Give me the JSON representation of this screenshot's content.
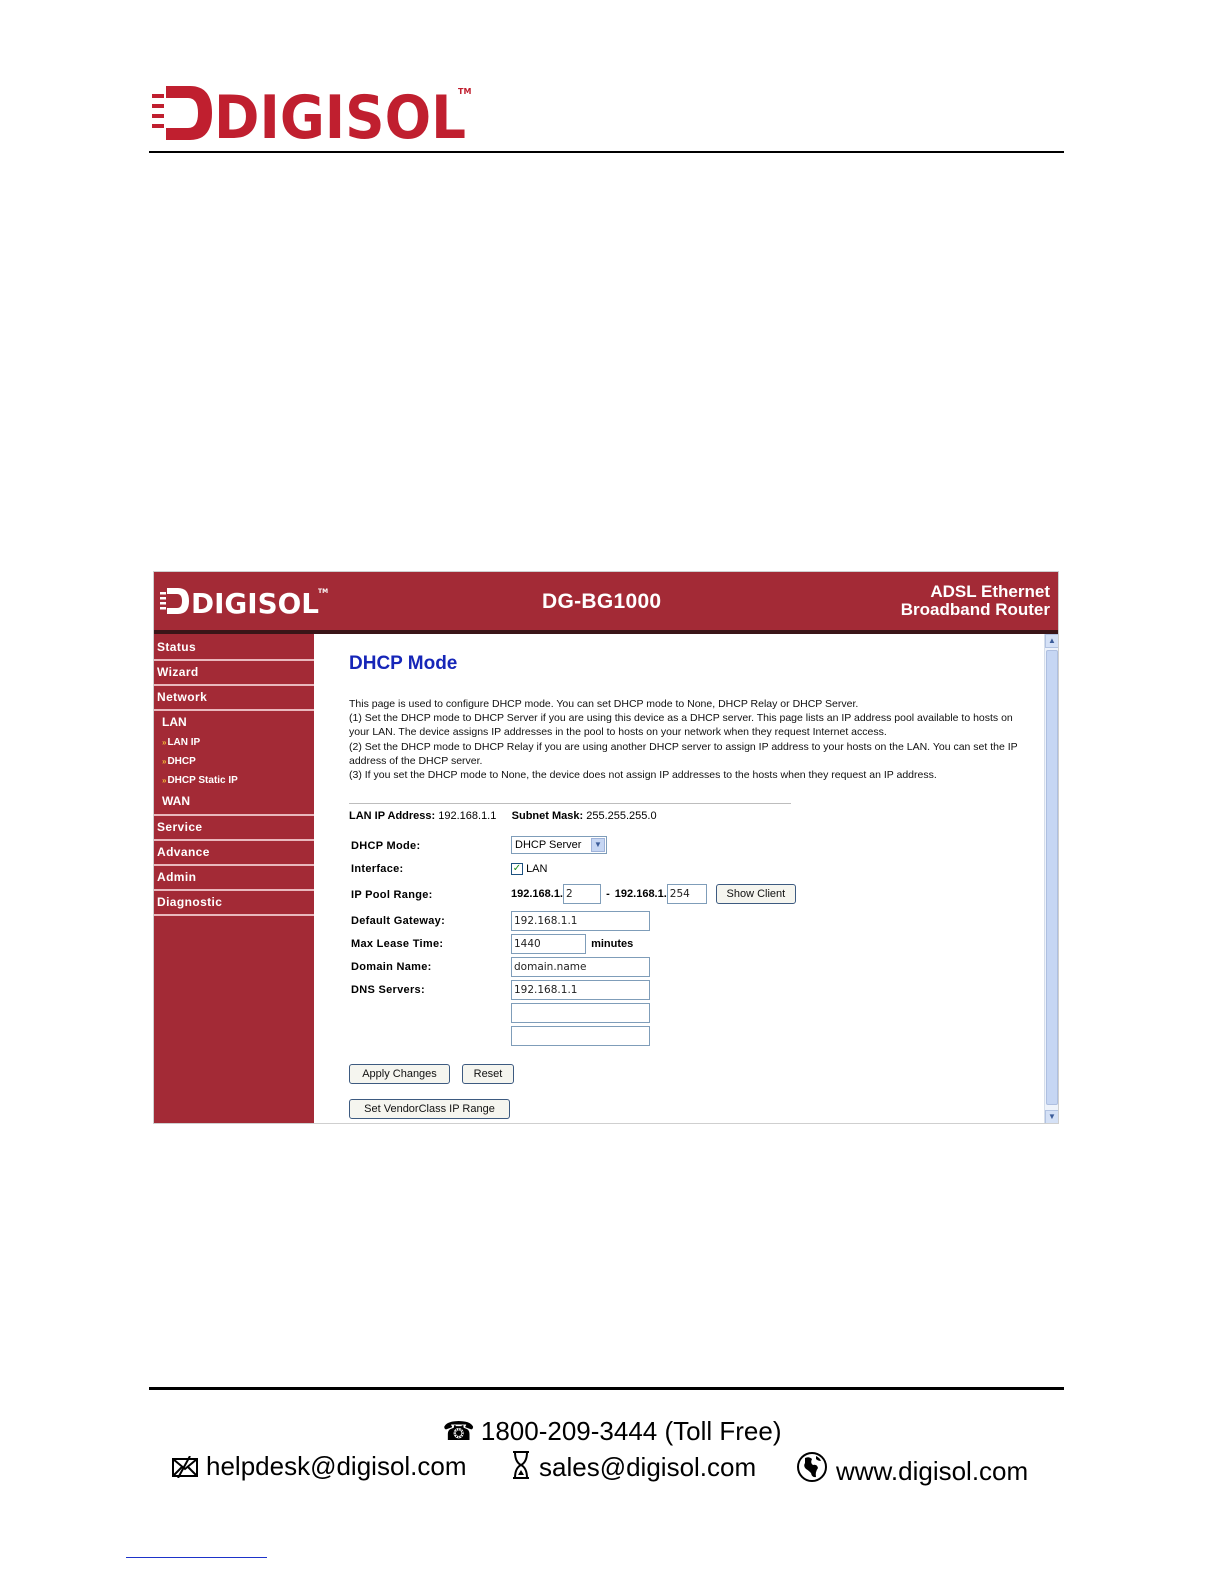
{
  "brand": {
    "name": "DIGISOL",
    "tm": "TM"
  },
  "router": {
    "model": "DG-BG1000",
    "tagline_line1": "ADSL Ethernet",
    "tagline_line2": "Broadband Router"
  },
  "sidebar": {
    "items": [
      {
        "label": "Status"
      },
      {
        "label": "Wizard"
      },
      {
        "label": "Network"
      }
    ],
    "lan_head": "LAN",
    "lan_links": [
      {
        "label": "LAN IP"
      },
      {
        "label": "DHCP"
      },
      {
        "label": "DHCP Static IP"
      }
    ],
    "wan_head": "WAN",
    "items_after": [
      {
        "label": "Service"
      },
      {
        "label": "Advance"
      },
      {
        "label": "Admin"
      },
      {
        "label": "Diagnostic"
      }
    ]
  },
  "page": {
    "title": "DHCP Mode",
    "description": [
      "This page is used to configure DHCP mode. You can set DHCP mode to None, DHCP Relay or DHCP Server.",
      "(1) Set the DHCP mode to DHCP Server if you are using this device as a DHCP server. This page lists an IP address pool available to hosts on your LAN. The device assigns IP addresses in the pool to hosts on your network when they request Internet access.",
      "(2) Set the DHCP mode to DHCP Relay if you are using another DHCP server to assign IP address to your hosts on the LAN. You can set the IP address of the DHCP server.",
      "(3) If you set the DHCP mode to None, the device does not assign IP addresses to the hosts when they request an IP address."
    ],
    "lan_ip_label": "LAN IP Address:",
    "lan_ip_value": "192.168.1.1",
    "subnet_label": "Subnet Mask:",
    "subnet_value": "255.255.255.0"
  },
  "form": {
    "dhcp_mode_label": "DHCP Mode:",
    "dhcp_mode_value": "DHCP Server",
    "interface_label": "Interface:",
    "interface_option": "LAN",
    "pool_label": "IP Pool Range:",
    "pool_prefix_start": "192.168.1.",
    "pool_start": "2",
    "pool_separator": "-",
    "pool_prefix_end": "192.168.1.",
    "pool_end": "254",
    "show_client_label": "Show Client",
    "gateway_label": "Default Gateway:",
    "gateway_value": "192.168.1.1",
    "lease_label": "Max Lease Time:",
    "lease_value": "1440",
    "lease_unit": "minutes",
    "domain_label": "Domain Name:",
    "domain_value": "domain.name",
    "dns_label": "DNS Servers:",
    "dns1_value": "192.168.1.1",
    "dns2_value": "",
    "dns3_value": "",
    "apply_label": "Apply Changes",
    "reset_label": "Reset",
    "vendor_label": "Set VendorClass IP Range"
  },
  "footer": {
    "phone": "1800-209-3444 (Toll Free)",
    "email": "helpdesk@digisol.com",
    "sales": "sales@digisol.com",
    "website": "www.digisol.com"
  },
  "icons": {
    "phone": "phone-icon",
    "email": "envelope-icon",
    "sales": "hourglass-icon",
    "website": "globe-icon"
  },
  "colors": {
    "brand_red": "#a32a36",
    "title_blue": "#1626b8"
  }
}
